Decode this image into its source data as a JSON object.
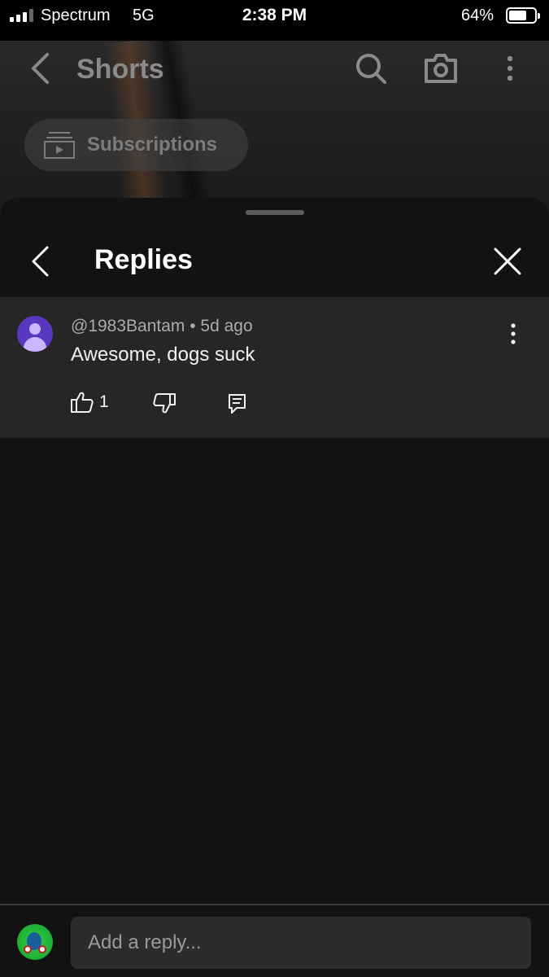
{
  "status_bar": {
    "carrier": "Spectrum",
    "network": "5G",
    "time": "2:38 PM",
    "battery_percent": "64%",
    "battery_level": 0.64
  },
  "background_header": {
    "title": "Shorts",
    "back_icon": "chevron-left-icon",
    "search_icon": "search-icon",
    "camera_icon": "camera-icon",
    "more_icon": "more-vertical-icon",
    "subscriptions_chip": "Subscriptions",
    "subscriptions_icon": "subscriptions-icon"
  },
  "sheet": {
    "title": "Replies",
    "back_icon": "chevron-left-icon",
    "close_icon": "close-icon"
  },
  "comment": {
    "author": "@1983Bantam",
    "separator": "•",
    "age": "5d ago",
    "meta": "@1983Bantam • 5d ago",
    "text": "Awesome, dogs suck",
    "like_count": "1",
    "avatar_color": "#5a37c0",
    "icons": [
      "thumbs-up-icon",
      "thumbs-down-icon",
      "reply-icon",
      "more-vertical-icon"
    ]
  },
  "reply_bar": {
    "placeholder": "Add a reply..."
  },
  "colors": {
    "sheet_background": "#121212",
    "comment_background": "#262626",
    "input_background": "#2c2c2c",
    "secondary_text": "#aaaaaa"
  }
}
